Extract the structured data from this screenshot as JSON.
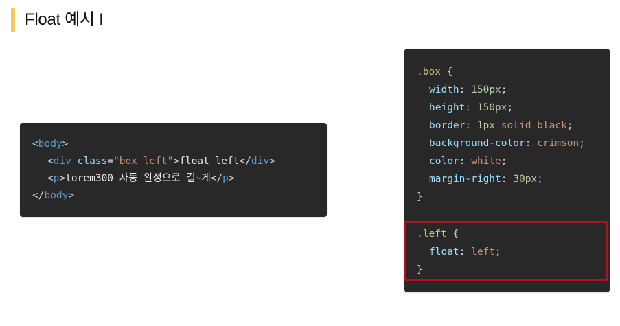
{
  "heading": {
    "title": "Float 예시 I",
    "accent_color": "#f4c85a"
  },
  "html_code": {
    "line1": {
      "open": "<",
      "tag": "body",
      "close": ">"
    },
    "line2": {
      "open": "<",
      "tag": "div",
      "sp": " ",
      "attr": "class",
      "eq": "=",
      "value": "\"box left\"",
      "close": ">",
      "text": "float left",
      "end_open": "</",
      "end_tag": "div",
      "end_close": ">"
    },
    "line3": {
      "open": "<",
      "tag": "p",
      "close": ">",
      "text": "lorem300 자동 완성으로 길~게",
      "end_open": "</",
      "end_tag": "p",
      "end_close": ">"
    },
    "line4": {
      "open": "</",
      "tag": "body",
      "close": ">"
    }
  },
  "css_code": {
    "rule1": {
      "selector": ".box",
      "brace_open": " {",
      "decls": [
        {
          "prop": "width",
          "value": "150px",
          "kind": "num"
        },
        {
          "prop": "height",
          "value": "150px",
          "kind": "num"
        },
        {
          "prop": "border",
          "value": "1px solid black",
          "kind": "mixed"
        },
        {
          "prop": "background-color",
          "value": "crimson",
          "kind": "val"
        },
        {
          "prop": "color",
          "value": "white",
          "kind": "val"
        },
        {
          "prop": "margin-right",
          "value": "30px",
          "kind": "num"
        }
      ],
      "brace_close": "}"
    },
    "rule2": {
      "selector": ".left",
      "brace_open": " {",
      "decls": [
        {
          "prop": "float",
          "value": "left",
          "kind": "val"
        }
      ],
      "brace_close": "}"
    }
  },
  "colors": {
    "code_background": "#282828",
    "highlight_border": "#b30f1f"
  }
}
